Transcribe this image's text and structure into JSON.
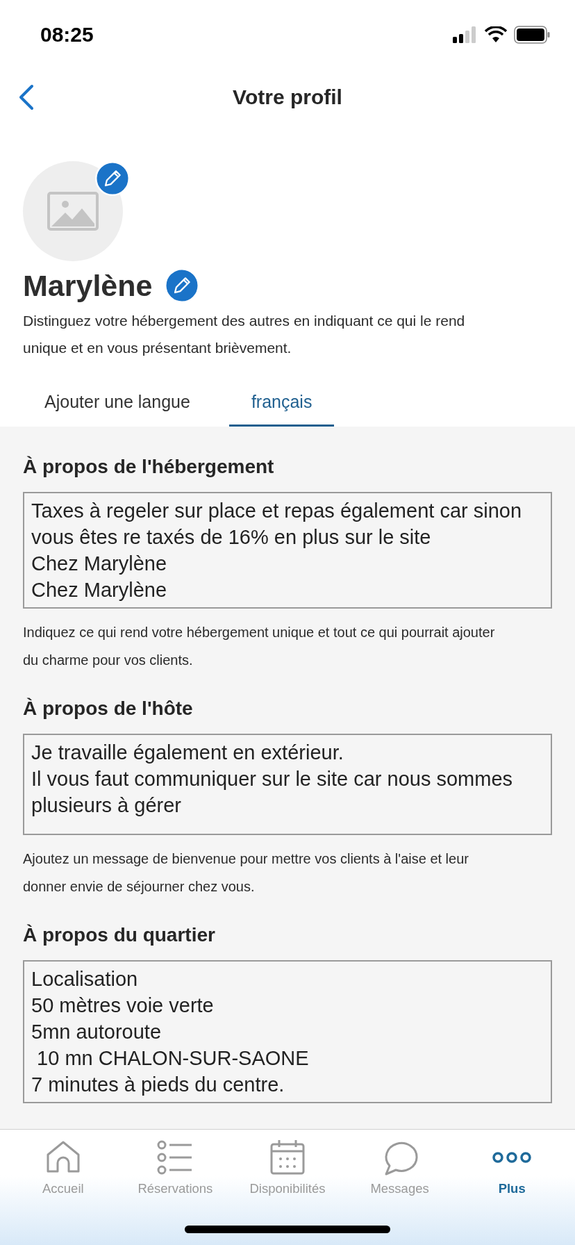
{
  "status_bar": {
    "time": "08:25"
  },
  "nav": {
    "title": "Votre profil"
  },
  "profile": {
    "name": "Marylène",
    "description": "Distinguez votre hébergement des autres en indiquant ce qui le rend unique et en vous présentant brièvement."
  },
  "tabs": [
    {
      "label": "Ajouter une langue",
      "selected": false
    },
    {
      "label": "français",
      "selected": true
    }
  ],
  "sections": [
    {
      "heading": "À propos de l'hébergement",
      "value": "Taxes à regeler sur place et repas également car sinon vous êtes re taxés de 16% en plus sur le site\nChez Marylène\nChez Marylène",
      "hint": "Indiquez ce qui rend votre hébergement unique et tout ce qui pourrait ajouter du charme pour vos clients."
    },
    {
      "heading": "À propos de l'hôte",
      "value": "Je travaille également en extérieur.\nIl vous faut communiquer sur le site car nous sommes plusieurs à gérer",
      "hint": "Ajoutez un message de bienvenue pour mettre vos clients à l'aise et leur donner envie de séjourner chez vous."
    },
    {
      "heading": "À propos du quartier",
      "value": "Localisation\n50 mètres voie verte\n5mn autoroute\n 10 mn CHALON-SUR-SAONE\n7 minutes à pieds du centre."
    }
  ],
  "tab_bar": [
    {
      "label": "Accueil",
      "kind": "home",
      "selected": false
    },
    {
      "label": "Réservations",
      "kind": "list",
      "selected": false
    },
    {
      "label": "Disponibilités",
      "kind": "calendar",
      "selected": false
    },
    {
      "label": "Messages",
      "kind": "chat",
      "selected": false
    },
    {
      "label": "Plus",
      "kind": "more",
      "selected": true
    }
  ]
}
